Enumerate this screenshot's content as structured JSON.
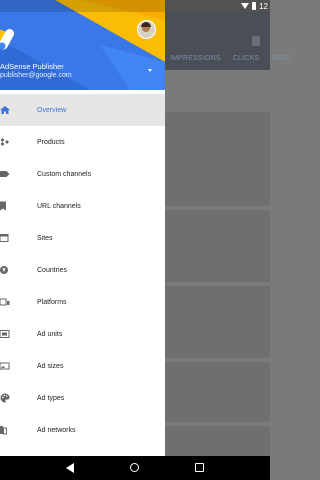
{
  "status_bar": {
    "time": "12"
  },
  "background_app": {
    "tabs": [
      "IMPRESSIONS",
      "CLICKS",
      "PAGE"
    ]
  },
  "drawer": {
    "account": {
      "name": "AdSense Publisher",
      "email": "publisher@google.com"
    },
    "menu_items": [
      {
        "label": "Overview",
        "icon": "home-icon",
        "active": true
      },
      {
        "label": "Products",
        "icon": "products-icon"
      },
      {
        "label": "Custom channels",
        "icon": "label-icon"
      },
      {
        "label": "URL channels",
        "icon": "bookmark-icon"
      },
      {
        "label": "Sites",
        "icon": "browser-window-icon"
      },
      {
        "label": "Countries",
        "icon": "globe-icon"
      },
      {
        "label": "Platforms",
        "icon": "devices-icon"
      },
      {
        "label": "Ad units",
        "icon": "ad-unit-icon"
      },
      {
        "label": "Ad sizes",
        "icon": "ad-size-icon"
      },
      {
        "label": "Ad types",
        "icon": "palette-icon"
      },
      {
        "label": "Ad networks",
        "icon": "network-icon"
      }
    ]
  },
  "colors": {
    "accent_blue": "#3d76d8",
    "header_yellow": "#fbbc04",
    "header_blue": "#3b78e7"
  }
}
